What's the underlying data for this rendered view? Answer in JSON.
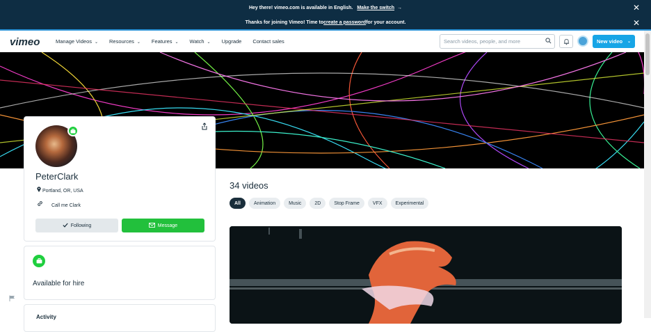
{
  "banner1": {
    "text": "Hey there! vimeo.com is available in English.",
    "link": "Make the switch",
    "arrow": "→",
    "close": "✕"
  },
  "banner2": {
    "text_before": "Thanks for joining Vimeo! Time to ",
    "link": "create a password",
    "text_after": " for your account.",
    "close": "✕"
  },
  "nav": {
    "logo": "vimeo",
    "items": [
      {
        "label": "Manage Videos",
        "has_dropdown": true
      },
      {
        "label": "Resources",
        "has_dropdown": true
      },
      {
        "label": "Features",
        "has_dropdown": true
      },
      {
        "label": "Watch",
        "has_dropdown": true
      },
      {
        "label": "Upgrade",
        "has_dropdown": false
      },
      {
        "label": "Contact sales",
        "has_dropdown": false
      }
    ],
    "search_placeholder": "Search videos, people, and more",
    "new_video_label": "New video",
    "accent_color": "#17a5e6"
  },
  "profile": {
    "name": "PeterClark",
    "location": "Portland, OR, USA",
    "link_text": "Call me Clark",
    "following_label": "Following",
    "message_label": "Message"
  },
  "hire": {
    "title": "Available for hire"
  },
  "activity": {
    "title": "Activity"
  },
  "videos": {
    "count_title": "34 videos",
    "filters": [
      {
        "label": "All",
        "active": true
      },
      {
        "label": "Animation",
        "active": false
      },
      {
        "label": "Music",
        "active": false
      },
      {
        "label": "2D",
        "active": false
      },
      {
        "label": "Stop Frame",
        "active": false
      },
      {
        "label": "VFX",
        "active": false
      },
      {
        "label": "Experimental",
        "active": false
      }
    ]
  }
}
